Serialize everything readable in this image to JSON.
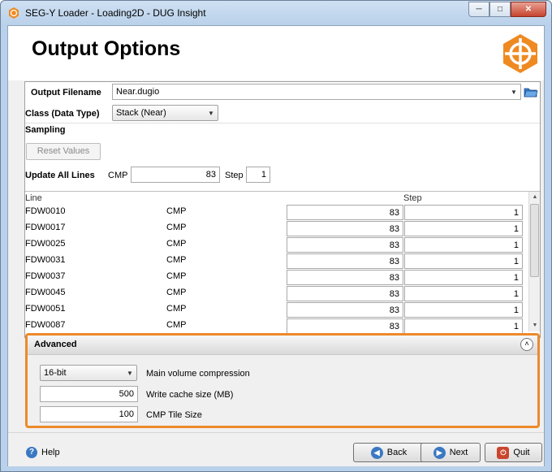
{
  "window": {
    "title": "SEG-Y Loader - Loading2D - DUG Insight"
  },
  "header": {
    "title": "Output Options"
  },
  "output": {
    "filename_label": "Output Filename",
    "filename_value": "Near.dugio",
    "class_label": "Class (Data Type)",
    "class_value": "Stack (Near)",
    "sampling_label": "Sampling",
    "reset_label": "Reset Values",
    "update_all_label": "Update All Lines",
    "cmp_label": "CMP",
    "cmp_value": "83",
    "step_label": "Step",
    "step_value": "1"
  },
  "table": {
    "columns": {
      "line": "Line",
      "step": "Step"
    },
    "rows": [
      {
        "line": "FDW0010",
        "type": "CMP",
        "cmp": "83",
        "step": "1"
      },
      {
        "line": "FDW0017",
        "type": "CMP",
        "cmp": "83",
        "step": "1"
      },
      {
        "line": "FDW0025",
        "type": "CMP",
        "cmp": "83",
        "step": "1"
      },
      {
        "line": "FDW0031",
        "type": "CMP",
        "cmp": "83",
        "step": "1"
      },
      {
        "line": "FDW0037",
        "type": "CMP",
        "cmp": "83",
        "step": "1"
      },
      {
        "line": "FDW0045",
        "type": "CMP",
        "cmp": "83",
        "step": "1"
      },
      {
        "line": "FDW0051",
        "type": "CMP",
        "cmp": "83",
        "step": "1"
      },
      {
        "line": "FDW0087",
        "type": "CMP",
        "cmp": "83",
        "step": "1"
      }
    ]
  },
  "advanced": {
    "title": "Advanced",
    "compression_value": "16-bit",
    "compression_label": "Main volume compression",
    "cache_value": "500",
    "cache_label": "Write cache size (MB)",
    "tile_value": "100",
    "tile_label": "CMP Tile Size"
  },
  "footer": {
    "help": "Help",
    "back": "Back",
    "next": "Next",
    "quit": "Quit"
  },
  "colors": {
    "accent": "#ec8a2a",
    "logo": "#ef8a22",
    "nav_icon": "#3b78c2",
    "quit_icon": "#c9462e"
  }
}
